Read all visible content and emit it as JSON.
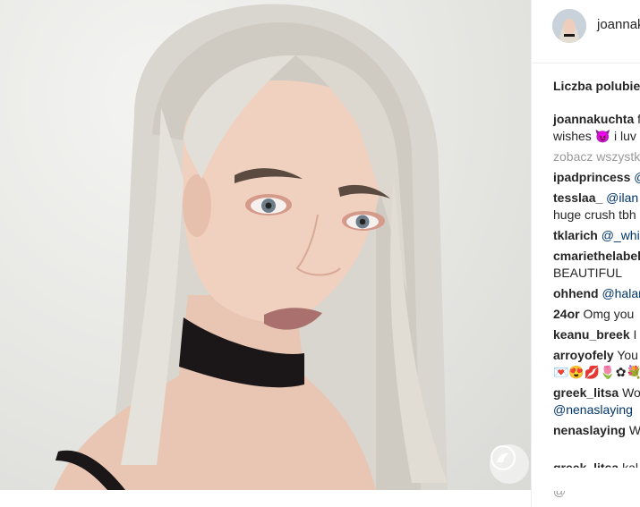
{
  "header": {
    "username": "joannak"
  },
  "likes_label": "Liczba polubie",
  "comments": [
    {
      "user": "joannakuchta",
      "text": "f",
      "cont": "wishes 😈 i luv"
    },
    {
      "more": "zobacz wszystk"
    },
    {
      "user": "ipadprincess",
      "text": "",
      "mention": "@"
    },
    {
      "user": "tesslaa_",
      "text": "",
      "mention": "@ilan",
      "cont": "huge crush tbh"
    },
    {
      "user": "tklarich",
      "text": "",
      "mention": "@_whi"
    },
    {
      "user": "cmariethelabel",
      "text": "",
      "cont": "BEAUTIFUL"
    },
    {
      "user": "ohhend",
      "text": "",
      "mention": "@halar"
    },
    {
      "user": "24or",
      "text": "Omg you"
    },
    {
      "user": "keanu_breek",
      "text": "I"
    },
    {
      "user": "arroyofely",
      "text": "You",
      "cont": "💌😍💋🌷✿💐♚"
    },
    {
      "user": "greek_litsa",
      "text": "Wo",
      "cont_mention": "@nenaslaying"
    },
    {
      "user": "nenaslaying",
      "text": "W"
    }
  ],
  "cut_user": "greek_litsa",
  "cut_text": "kal",
  "cut_bottom": "@",
  "icons": {
    "watermark": "kangaroo-logo-icon"
  }
}
